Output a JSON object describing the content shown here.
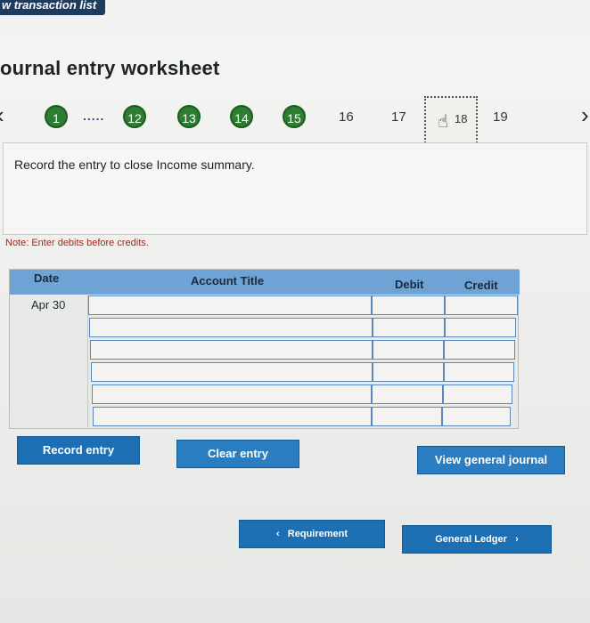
{
  "header": {
    "tab_link": "w transaction list"
  },
  "worksheet": {
    "title": "ournal entry worksheet",
    "steps": [
      {
        "label": "1",
        "state": "done"
      },
      {
        "label": "12",
        "state": "done"
      },
      {
        "label": "13",
        "state": "done"
      },
      {
        "label": "14",
        "state": "done"
      },
      {
        "label": "15",
        "state": "done"
      },
      {
        "label": "16",
        "state": "pending"
      },
      {
        "label": "17",
        "state": "pending"
      },
      {
        "label": "18",
        "state": "current"
      },
      {
        "label": "19",
        "state": "pending"
      }
    ],
    "dots": ".....",
    "instruction": "Record the entry to close Income summary.",
    "note": "Note: Enter debits before credits."
  },
  "journal": {
    "columns": {
      "date": "Date",
      "account": "Account Title",
      "debit": "Debit",
      "credit": "Credit"
    },
    "rows": [
      {
        "date": "Apr 30",
        "account": "",
        "debit": "",
        "credit": ""
      },
      {
        "date": "",
        "account": "",
        "debit": "",
        "credit": ""
      },
      {
        "date": "",
        "account": "",
        "debit": "",
        "credit": ""
      },
      {
        "date": "",
        "account": "",
        "debit": "",
        "credit": ""
      },
      {
        "date": "",
        "account": "",
        "debit": "",
        "credit": ""
      },
      {
        "date": "",
        "account": "",
        "debit": "",
        "credit": ""
      }
    ]
  },
  "buttons": {
    "record": "Record entry",
    "clear": "Clear entry",
    "view_journal": "View general journal",
    "requirement": "Requirement",
    "ledger": "General Ledger"
  },
  "colors": {
    "step_done": "#2e7d32",
    "header_blue": "#6fa3d6",
    "button_blue": "#1d6fb3",
    "note_red": "#a0281e"
  }
}
